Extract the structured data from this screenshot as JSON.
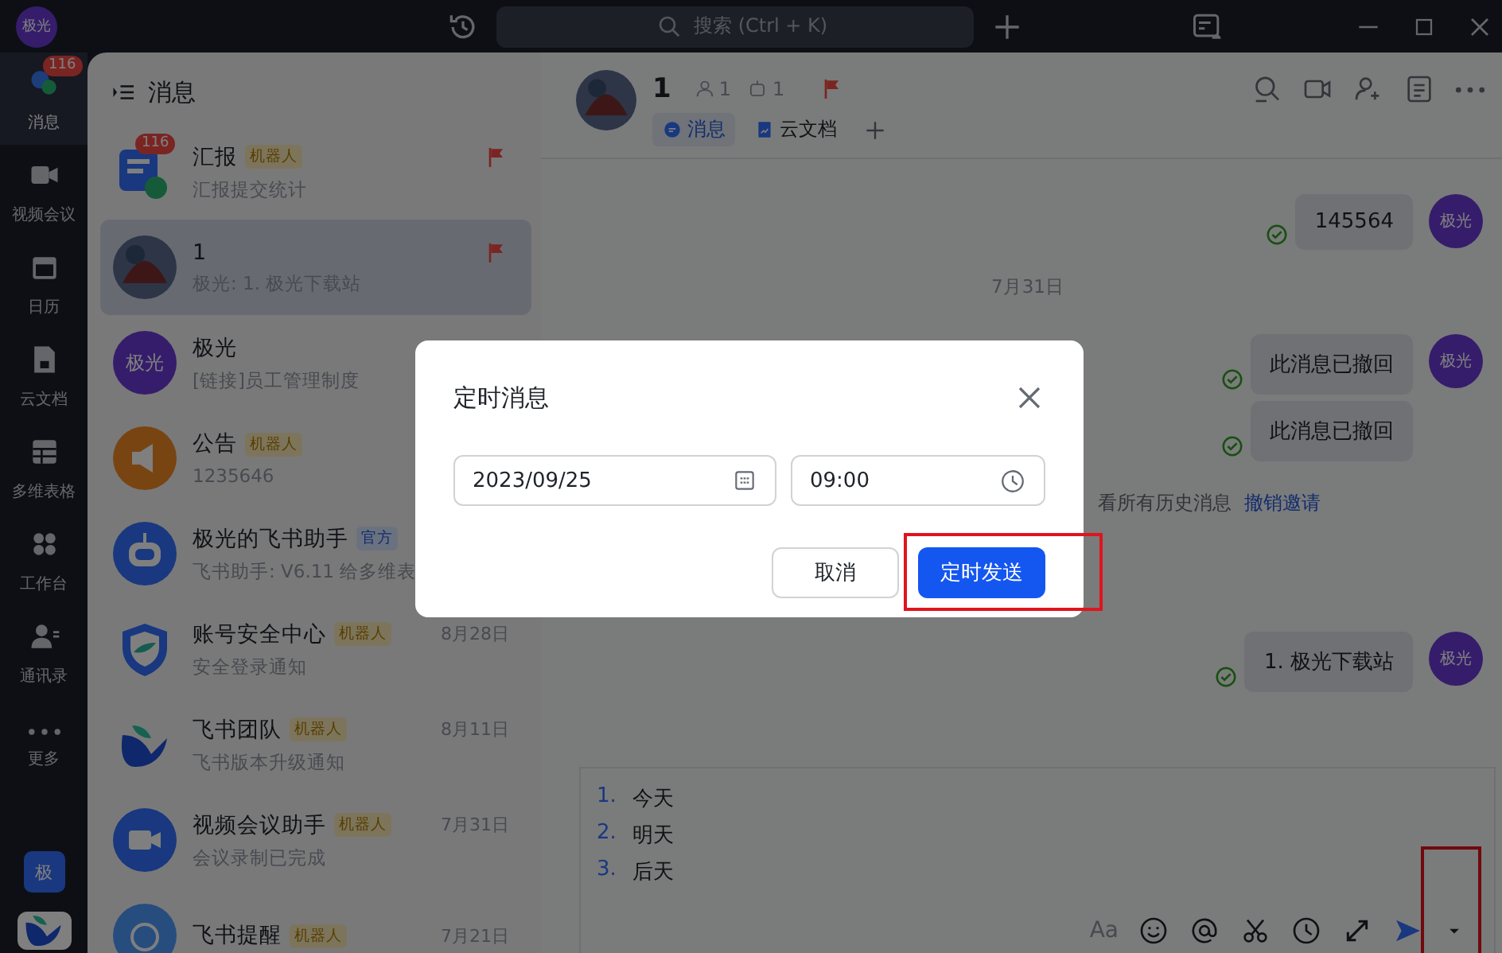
{
  "title_bar": {
    "avatar": "极光",
    "search_placeholder": "搜索 (Ctrl + K)"
  },
  "nav": [
    {
      "label": "消息",
      "kind": "chat",
      "selected": true,
      "badge": "116"
    },
    {
      "label": "视频会议",
      "kind": "video",
      "selected": false
    },
    {
      "label": "日历",
      "kind": "calendar",
      "selected": false
    },
    {
      "label": "云文档",
      "kind": "doc",
      "selected": false
    },
    {
      "label": "多维表格",
      "kind": "table",
      "selected": false
    },
    {
      "label": "工作台",
      "kind": "apps",
      "selected": false
    },
    {
      "label": "通讯录",
      "kind": "contacts",
      "selected": false
    },
    {
      "label": "更多",
      "kind": "more",
      "selected": false
    }
  ],
  "nav_bottom": {
    "workspace": "极"
  },
  "list": {
    "title": "消息",
    "items": [
      {
        "name": "汇报",
        "tag": {
          "text": "机器人",
          "kind": "robot"
        },
        "preview": "汇报提交统计",
        "badge": "116",
        "flagged": true,
        "selected": false,
        "avatar": {
          "kind": "report"
        }
      },
      {
        "name": "1",
        "preview": "极光: 1. 极光下载站",
        "flagged": true,
        "selected": true,
        "avatar": {
          "kind": "photo"
        }
      },
      {
        "name": "极光",
        "preview": "[链接]员工管理制度",
        "flagged": false,
        "selected": false,
        "avatar": {
          "kind": "text",
          "text": "极光"
        }
      },
      {
        "name": "公告",
        "tag": {
          "text": "机器人",
          "kind": "robot"
        },
        "preview": "1235646",
        "flagged": false,
        "selected": false,
        "avatar": {
          "kind": "announce"
        }
      },
      {
        "name": "极光的飞书助手",
        "tag": {
          "text": "官方",
          "kind": "official"
        },
        "preview": "飞书助手: V6.11 给多维表",
        "flagged": false,
        "selected": false,
        "avatar": {
          "kind": "bot"
        }
      },
      {
        "name": "账号安全中心",
        "tag": {
          "text": "机器人",
          "kind": "robot"
        },
        "date": "8月28日",
        "preview": "安全登录通知",
        "flagged": false,
        "selected": false,
        "avatar": {
          "kind": "shield"
        }
      },
      {
        "name": "飞书团队",
        "tag": {
          "text": "机器人",
          "kind": "robot"
        },
        "date": "8月11日",
        "preview": "飞书版本升级通知",
        "flagged": false,
        "selected": false,
        "avatar": {
          "kind": "team"
        }
      },
      {
        "name": "视频会议助手",
        "tag": {
          "text": "机器人",
          "kind": "robot"
        },
        "date": "7月31日",
        "preview": "会议录制已完成",
        "flagged": false,
        "selected": false,
        "avatar": {
          "kind": "video"
        }
      },
      {
        "name": "飞书提醒",
        "tag": {
          "text": "机器人",
          "kind": "robot"
        },
        "date": "7月21日",
        "flagged": false,
        "selected": false,
        "avatar": {
          "kind": "remind"
        }
      }
    ]
  },
  "chat": {
    "name": "1",
    "members": "1",
    "bots": "1",
    "flagged": true,
    "tabs": [
      {
        "label": "消息",
        "selected": true
      },
      {
        "label": "云文档",
        "selected": false
      }
    ],
    "messages": [
      {
        "kind": "outgoing",
        "text": "145564",
        "avatar": "极光"
      },
      {
        "kind": "date",
        "text": "7月31日"
      },
      {
        "kind": "outgoing",
        "text": "此消息已撤回",
        "avatar": "极光"
      },
      {
        "kind": "outgoing",
        "text": "此消息已撤回"
      },
      {
        "kind": "system",
        "text": "看所有历史消息",
        "link": "撤销邀请"
      },
      {
        "kind": "outgoing",
        "text": "1. 极光下载站",
        "avatar": "极光"
      }
    ],
    "composer": {
      "lines": [
        {
          "number": "1.",
          "text": "今天"
        },
        {
          "number": "2.",
          "text": "明天"
        },
        {
          "number": "3.",
          "text": "后天"
        }
      ],
      "toolbar": [
        {
          "kind": "font",
          "text": "Aa",
          "highlighted": false
        },
        {
          "kind": "emoji",
          "highlighted": false
        },
        {
          "kind": "mention",
          "highlighted": false
        },
        {
          "kind": "screenshot",
          "highlighted": false
        },
        {
          "kind": "schedule",
          "highlighted": false
        },
        {
          "kind": "expand",
          "highlighted": false
        },
        {
          "kind": "send",
          "highlighted": false
        },
        {
          "kind": "send-options",
          "highlighted": true
        }
      ]
    }
  },
  "dialog": {
    "title": "定时消息",
    "date": "2023/09/25",
    "time": "09:00",
    "cancel": {
      "label": "取消"
    },
    "confirm": {
      "label": "定时发送",
      "highlighted": true
    }
  }
}
